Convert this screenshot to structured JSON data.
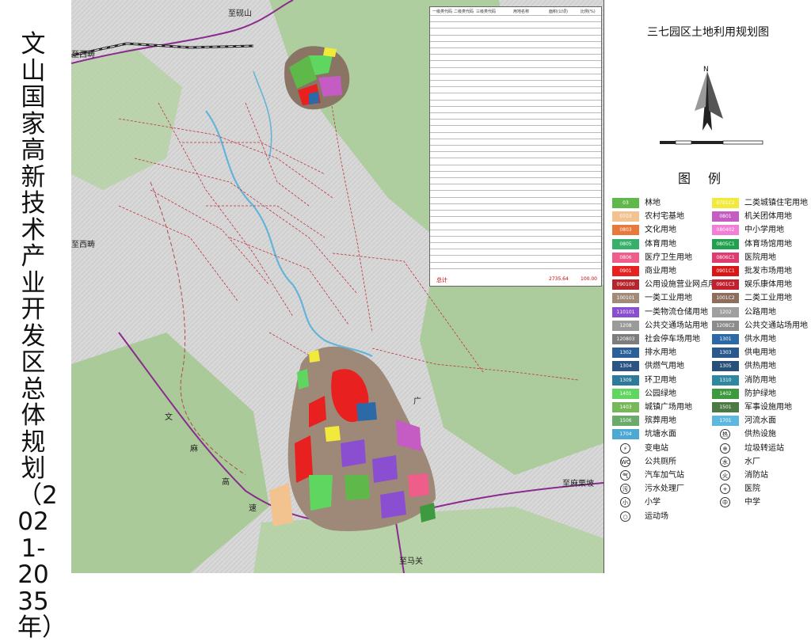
{
  "title": "文山国家高新技术产业开发区总体规划（2021-2035年）",
  "panel_title": "三七园区土地利用规划图",
  "legend_title": "图例",
  "map_labels": {
    "to_yanshan": "至砚山",
    "to_malipo": "至麻栗坡",
    "to_xichou": "至西畴",
    "text_1": "文",
    "text_2": "麻",
    "text_3": "高",
    "text_4": "速",
    "text_5": "广",
    "text_6": "至马关",
    "text_7": "至西畴"
  },
  "table": {
    "col_headers": [
      "一级类代码",
      "二级类代码",
      "三级类代码",
      "用地名称",
      "面积(公顷)",
      "比例(%)"
    ],
    "total_label": "总计",
    "total_area": "2735.64",
    "total_pct": "100.00"
  },
  "legend_items": [
    {
      "code": "03",
      "label": "林地",
      "color": "#5fb94a"
    },
    {
      "code": "0701C2",
      "label": "二类城镇住宅用地",
      "color": "#f1ea3a"
    },
    {
      "code": "0703",
      "label": "农村宅基地",
      "color": "#f3c38f"
    },
    {
      "code": "0801",
      "label": "机关团体用地",
      "color": "#c45cc4"
    },
    {
      "code": "0803",
      "label": "文化用地",
      "color": "#e8793a"
    },
    {
      "code": "080402",
      "label": "中小学用地",
      "color": "#f27fd5"
    },
    {
      "code": "0805",
      "label": "体育用地",
      "color": "#37b06b"
    },
    {
      "code": "0805C1",
      "label": "体育场馆用地",
      "color": "#1fa14f"
    },
    {
      "code": "0806",
      "label": "医疗卫生用地",
      "color": "#ef5d8a"
    },
    {
      "code": "0806C1",
      "label": "医院用地",
      "color": "#e03a6f"
    },
    {
      "code": "0901",
      "label": "商业用地",
      "color": "#e82020"
    },
    {
      "code": "0901C1",
      "label": "批发市场用地",
      "color": "#d91515"
    },
    {
      "code": "090100",
      "label": "公用设施营业网点用地",
      "color": "#b5252b"
    },
    {
      "code": "0901C3",
      "label": "娱乐康体用地",
      "color": "#c2202f"
    },
    {
      "code": "100101",
      "label": "一类工业用地",
      "color": "#a28a78"
    },
    {
      "code": "1001C2",
      "label": "二类工业用地",
      "color": "#8d6e5c"
    },
    {
      "code": "110101",
      "label": "一类物流仓储用地",
      "color": "#8a4fd1"
    },
    {
      "code": "1202",
      "label": "公路用地",
      "color": "#a0a0a0"
    },
    {
      "code": "1208",
      "label": "公共交通场站用地",
      "color": "#9a9a9a"
    },
    {
      "code": "1208C2",
      "label": "公共交通站场用地",
      "color": "#8c8c8c"
    },
    {
      "code": "120803",
      "label": "社会停车场用地",
      "color": "#7d7d7d"
    },
    {
      "code": "1301",
      "label": "供水用地",
      "color": "#2c6aa7"
    },
    {
      "code": "1302",
      "label": "排水用地",
      "color": "#2a5f97"
    },
    {
      "code": "1303",
      "label": "供电用地",
      "color": "#2a5a8d"
    },
    {
      "code": "1304",
      "label": "供燃气用地",
      "color": "#2a5583"
    },
    {
      "code": "1305",
      "label": "供热用地",
      "color": "#275079"
    },
    {
      "code": "1309",
      "label": "环卫用地",
      "color": "#2d7a9a"
    },
    {
      "code": "1310",
      "label": "消防用地",
      "color": "#2f87a0"
    },
    {
      "code": "1401",
      "label": "公园绿地",
      "color": "#5fd65f"
    },
    {
      "code": "1402",
      "label": "防护绿地",
      "color": "#3e9a3e"
    },
    {
      "code": "1403",
      "label": "城镇广场用地",
      "color": "#77b85a"
    },
    {
      "code": "1501",
      "label": "军事设施用地",
      "color": "#4c7a44"
    },
    {
      "code": "1506",
      "label": "殡葬用地",
      "color": "#6aaa6a"
    },
    {
      "code": "1701",
      "label": "河流水面",
      "color": "#5db8e0"
    },
    {
      "code": "1704",
      "label": "坑塘水面",
      "color": "#4ea8d4"
    },
    {
      "code": "",
      "label": "供热设施",
      "color": ""
    }
  ],
  "symbol_items": [
    {
      "label": "变电站",
      "glyph": "⚡"
    },
    {
      "label": "垃圾转运站",
      "glyph": "⊕"
    },
    {
      "label": "公共厕所",
      "glyph": "WC"
    },
    {
      "label": "水厂",
      "glyph": "水"
    },
    {
      "label": "汽车加气站",
      "glyph": "气"
    },
    {
      "label": "消防站",
      "glyph": "火"
    },
    {
      "label": "污水处理厂",
      "glyph": "污"
    },
    {
      "label": "医院",
      "glyph": "+"
    },
    {
      "label": "小学",
      "glyph": "小"
    },
    {
      "label": "中学",
      "glyph": "中"
    },
    {
      "label": "运动场",
      "glyph": "○"
    }
  ],
  "colors": {
    "terrain": "#d9d9d9",
    "forest": "#9cc78a",
    "road_main": "#8b2a8f",
    "river": "#63b4d8",
    "red_dash": "#c2303a",
    "industrial": "#9e8877"
  }
}
